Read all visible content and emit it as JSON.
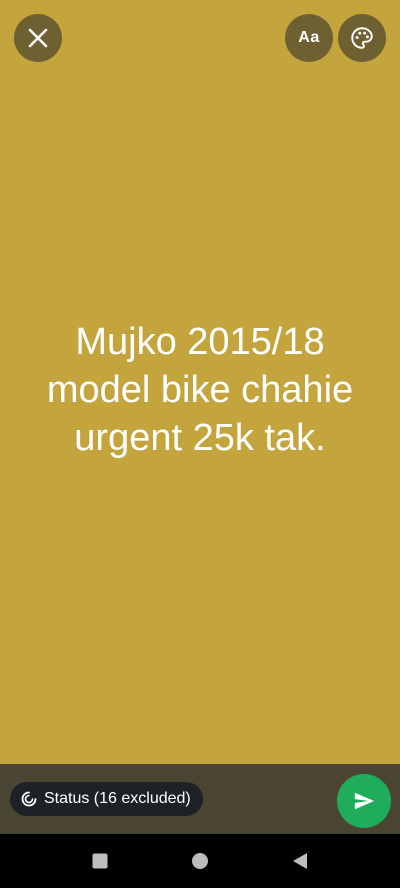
{
  "status_text": {
    "lines": [
      "Mujko 2015/18",
      "model bike chahie",
      "urgent 25k tak."
    ]
  },
  "toolbar": {
    "font_label": "Aa"
  },
  "audience": {
    "label": "Status (16 excluded)"
  },
  "colors": {
    "background": "#c4a53d",
    "bottom_bar": "#4a4532",
    "send_button": "#1fad5c",
    "pill": "#1e2226"
  },
  "icons": {
    "close": "close-icon",
    "palette": "palette-icon",
    "audience": "status-ring-icon",
    "send": "send-icon",
    "recents": "square-icon",
    "home": "circle-icon",
    "back": "triangle-back-icon"
  }
}
